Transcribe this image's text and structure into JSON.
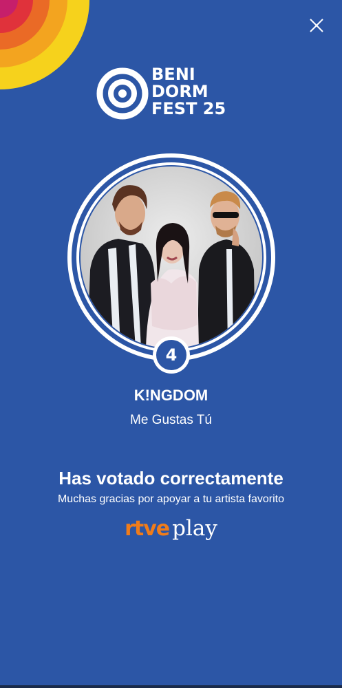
{
  "header": {
    "logo_lines": [
      "BENI",
      "DORM",
      "FEST 25"
    ],
    "close_icon": "close-icon"
  },
  "artist": {
    "number": "4",
    "name": "K!NGDOM",
    "song": "Me Gustas Tú"
  },
  "confirmation": {
    "heading": "Has votado correctamente",
    "subtext": "Muchas gracias por apoyar a tu artista favorito"
  },
  "brand": {
    "part1": "rtve",
    "part2": "play"
  },
  "colors": {
    "background": "#2c56a6",
    "accent_orange": "#f07c1a",
    "arc_colors": [
      "#f6d21c",
      "#f3a41f",
      "#ea6a26",
      "#e0323b",
      "#c61f6b"
    ],
    "text": "#ffffff"
  }
}
